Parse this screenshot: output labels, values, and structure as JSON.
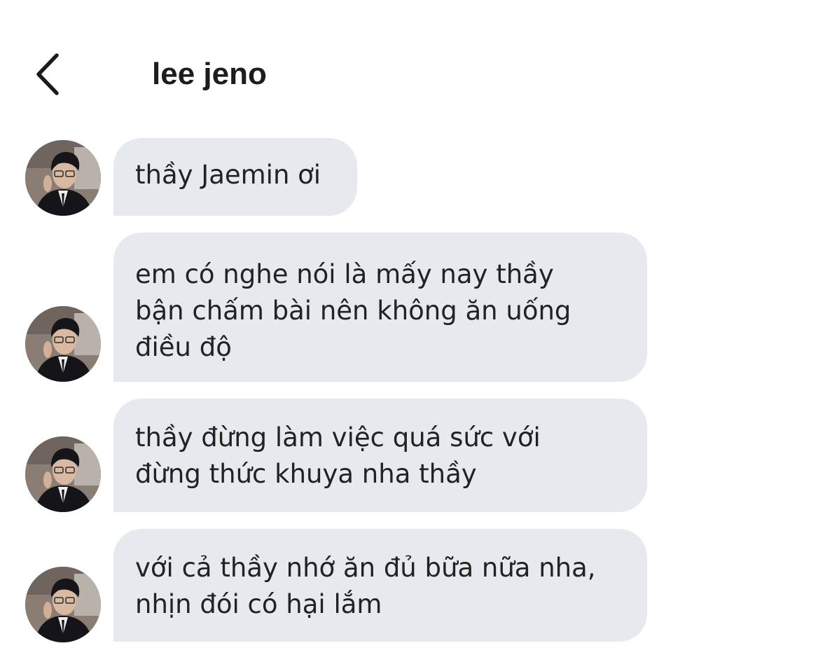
{
  "header": {
    "title": "lee jeno",
    "back_icon": "chevron-left-icon"
  },
  "messages": [
    {
      "lines": [
        "thầy Jaemin ơi"
      ]
    },
    {
      "lines": [
        "em có nghe nói là mấy nay thầy",
        "bận chấm bài nên không ăn uống",
        "điều độ"
      ]
    },
    {
      "lines": [
        "thầy đừng làm việc quá sức với",
        "đừng thức khuya nha thầy"
      ]
    },
    {
      "lines": [
        "với cả thầy nhớ ăn đủ bữa nữa nha,",
        "nhịn đói có hại lắm"
      ]
    }
  ],
  "colors": {
    "bubble": "#e6eaef",
    "text": "#222222",
    "background": "#ffffff"
  }
}
